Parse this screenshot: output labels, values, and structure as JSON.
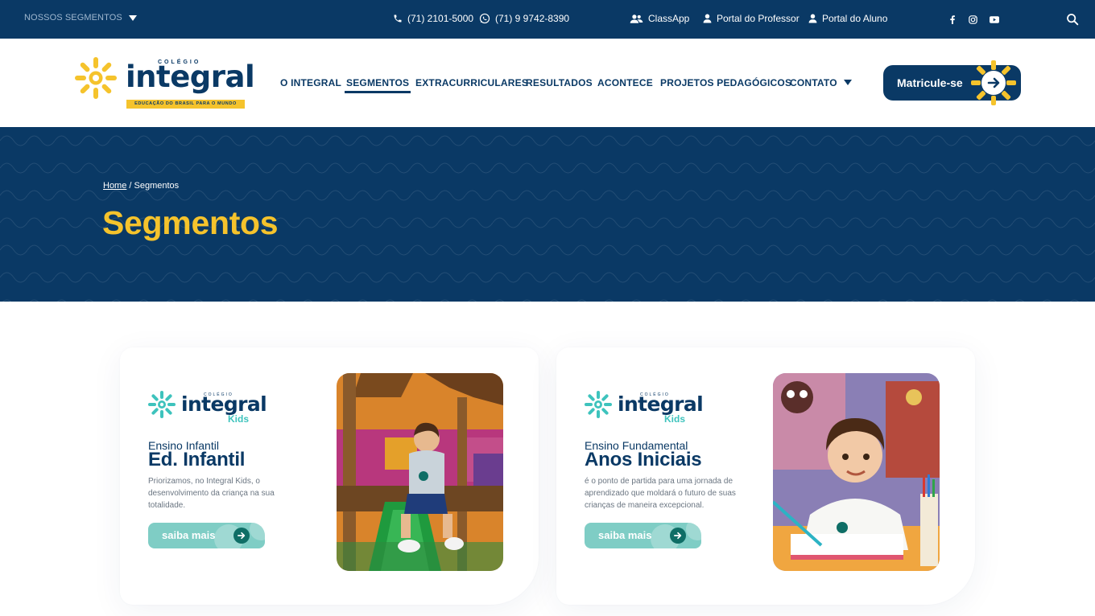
{
  "topbar": {
    "segments_label": "NOSSOS SEGMENTOS",
    "phone": "(71) 2101-5000",
    "whatsapp": "(71) 9 9742-8390",
    "links": [
      "ClassApp",
      "Portal do Professor",
      "Portal do Aluno"
    ],
    "social": [
      "facebook-icon",
      "instagram-icon",
      "youtube-icon"
    ]
  },
  "logo": {
    "colegio": "COLÉGIO",
    "name": "integral",
    "tagline": "EDUCAÇÃO DO BRASIL PARA O MUNDO"
  },
  "nav": {
    "items": [
      "O INTEGRAL",
      "SEGMENTOS",
      "EXTRACURRICULARES",
      "RESULTADOS",
      "ACONTECE",
      "PROJETOS PEDAGÓGICOS",
      "CONTATO"
    ],
    "active": "SEGMENTOS",
    "cta": "Matricule-se"
  },
  "hero": {
    "breadcrumb_home": "Home",
    "breadcrumb_sep": " / ",
    "breadcrumb_current": "Segmentos",
    "title": "Segmentos"
  },
  "cards": [
    {
      "logo_colegio": "COLÉGIO",
      "logo_name": "integral",
      "logo_sub": "Kids",
      "category": "Ensino Infantil",
      "title": "Ed. Infantil",
      "description": "Priorizamos, no Integral Kids, o desenvolvimento da criança na sua totalidade.",
      "button": "saiba mais"
    },
    {
      "logo_colegio": "COLÉGIO",
      "logo_name": "integral",
      "logo_sub": "Kids",
      "category": "Ensino Fundamental",
      "title": "Anos Iniciais",
      "description": "é o ponto de partida para uma jornada de aprendizado que moldará o futuro de suas crianças de maneira excepcional.",
      "button": "saiba mais"
    }
  ],
  "colors": {
    "navy": "#0a3965",
    "yellow": "#f5c32c",
    "teal": "#3ec3bd",
    "teal_button": "#7fcdc5"
  }
}
